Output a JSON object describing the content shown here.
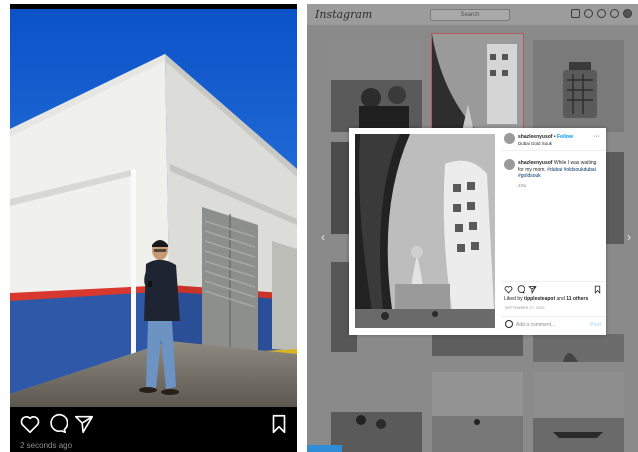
{
  "mobile": {
    "timestamp": "2 seconds ago",
    "icons": [
      "heart-icon",
      "comment-icon",
      "share-icon",
      "bookmark-icon"
    ]
  },
  "desktop": {
    "logo": "Instagram",
    "search_placeholder": "Search",
    "nav_icons": [
      "home-icon",
      "messenger-icon",
      "explore-icon",
      "heart-icon",
      "avatar-icon"
    ],
    "modal": {
      "username": "shazleenyusof",
      "follow_label": "Follow",
      "separator": " • ",
      "location": "Dubai Gold Souk",
      "caption_user": "shazleenyusof",
      "caption_text": "While I was waiting for my mom.",
      "hashtags": "#dubai #oldsoukdubai #goldsouk",
      "time_ago": "23w",
      "liked_by_prefix": "Liked by ",
      "liked_by_user": "tipplesteapot",
      "liked_by_suffix": " and ",
      "liked_by_others": "11 others",
      "date": "SEPTEMBER 27, 2022",
      "comment_placeholder": "Add a comment...",
      "post_label": "Post"
    }
  },
  "colors": {
    "sky": "#1f6fd6",
    "wall_blue": "#2f58a8",
    "wall_red": "#d8382e",
    "ig_link": "#0095f6",
    "overlay_gray": "#8a8a8a"
  }
}
